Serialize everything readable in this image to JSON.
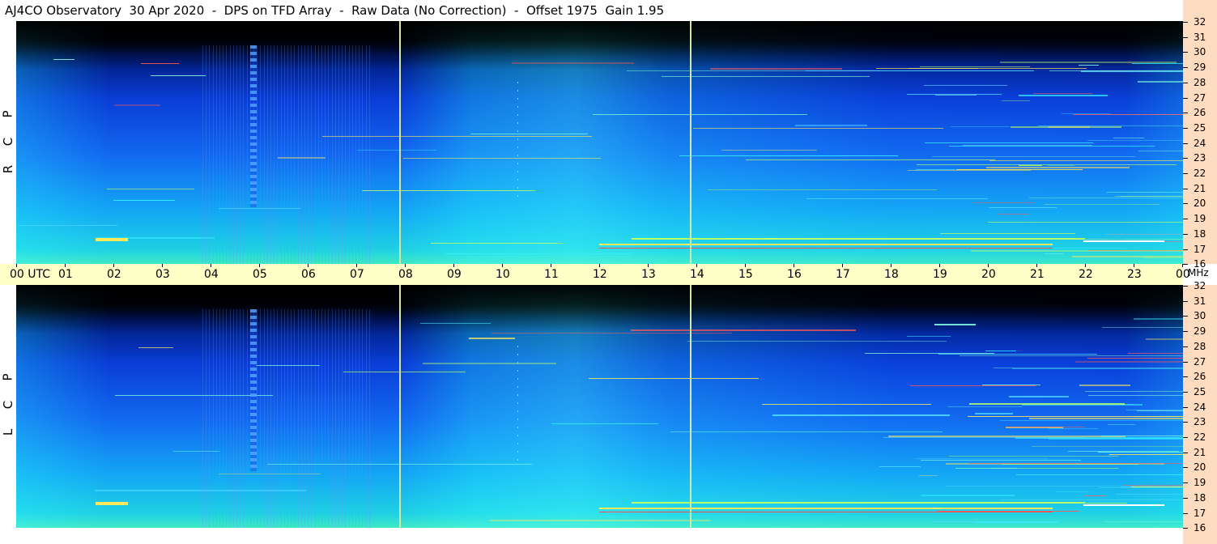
{
  "title": "AJ4CO Observatory  30 Apr 2020  -  DPS on TFD Array  -  Raw Data (No Correction)  -  Offset 1975  Gain 1.95",
  "panels": [
    {
      "id": "rcp",
      "label_letters": [
        "P",
        "C",
        "R"
      ]
    },
    {
      "id": "lcp",
      "label_letters": [
        "P",
        "C",
        "L"
      ]
    }
  ],
  "freq_ticks": [
    "32",
    "31",
    "30",
    "29",
    "28",
    "27",
    "26",
    "25",
    "24",
    "23",
    "22",
    "21",
    "20",
    "19",
    "18",
    "17",
    "16"
  ],
  "time_labels": [
    "00  UTC",
    "01",
    "02",
    "03",
    "04",
    "05",
    "06",
    "07",
    "08",
    "09",
    "10",
    "11",
    "12",
    "13",
    "14",
    "15",
    "16",
    "17",
    "18",
    "19",
    "20",
    "21",
    "22",
    "23",
    "00"
  ],
  "mhz_label": "MHz",
  "colors": {
    "plot_dark": "#000000",
    "plot_blue": "#1268f0",
    "plot_cyan": "#1fd0e4",
    "time_axis_bg": "#ffffc8",
    "freq_axis_bg": "#ffdcc0",
    "calibration_line": "#d6e8a0"
  }
}
